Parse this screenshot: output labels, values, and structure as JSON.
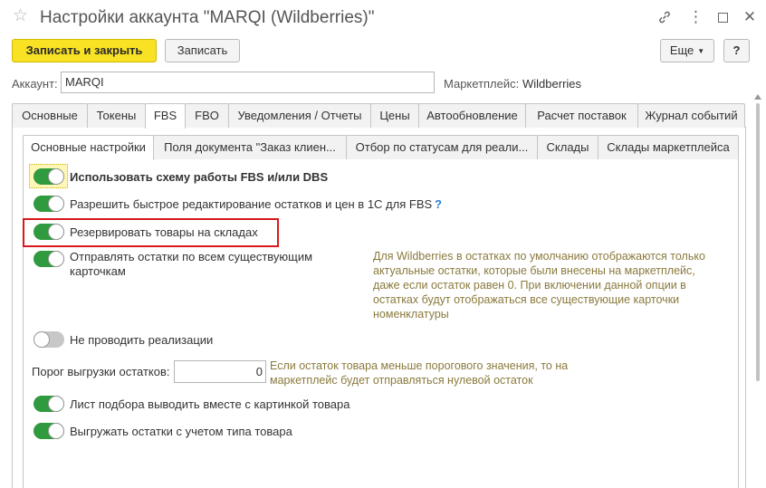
{
  "window": {
    "title": "Настройки аккаунта \"MARQI (Wildberries)\"",
    "icons": [
      "star-icon",
      "link-icon",
      "more-icon",
      "maximize-icon",
      "close-icon"
    ]
  },
  "toolbar": {
    "save_close_label": "Записать и закрыть",
    "save_label": "Записать",
    "more_label": "Еще",
    "help_label": "?"
  },
  "account": {
    "label": "Аккаунт:",
    "value": "MARQI",
    "marketplace_label": "Маркетплейс:",
    "marketplace_value": "Wildberries"
  },
  "tabs": [
    {
      "label": "Основные"
    },
    {
      "label": "Токены"
    },
    {
      "label": "FBS",
      "active": true
    },
    {
      "label": "FBO"
    },
    {
      "label": "Уведомления / Отчеты"
    },
    {
      "label": "Цены"
    },
    {
      "label": "Автообновление"
    },
    {
      "label": "Расчет поставок"
    },
    {
      "label": "Журнал событий"
    }
  ],
  "subtabs": [
    {
      "label": "Основные настройки",
      "active": true
    },
    {
      "label": "Поля документа \"Заказ клиен..."
    },
    {
      "label": "Отбор по статусам для реали..."
    },
    {
      "label": "Склады"
    },
    {
      "label": "Склады маркетплейса"
    }
  ],
  "settings": {
    "use_fbs_dbs": {
      "label": "Использовать схему работы FBS и/или DBS",
      "on": true
    },
    "quick_edit": {
      "label": "Разрешить быстрое редактирование остатков и цен в 1С для FBS",
      "help": "?",
      "on": true
    },
    "reserve": {
      "label": "Резервировать товары на складах",
      "on": true
    },
    "send_all": {
      "label_line1": "Отправлять остатки по всем существующим",
      "label_line2": "карточкам",
      "on": true
    },
    "send_all_note": [
      "Для Wildberries в остатках по умолчанию отображаются только",
      "актуальные остатки, которые были внесены на маркетплейс,",
      "даже если остаток равен 0. При включении данной опции в",
      "остатках будут отображаться все существующие карточки",
      "номенклатуры"
    ],
    "no_sales": {
      "label": "Не проводить реализации",
      "on": false
    },
    "threshold": {
      "label": "Порог выгрузки остатков:",
      "value": "0",
      "note": [
        "Если остаток товара меньше порогового значения, то на",
        "маркетплейс будет отправляться нулевой остаток"
      ]
    },
    "pick_list_image": {
      "label": "Лист подбора выводить вместе с картинкой товара",
      "on": true
    },
    "stock_by_type": {
      "label": "Выгружать остатки с учетом типа товара",
      "on": true
    }
  },
  "colors": {
    "primary_button": "#f8e223",
    "toggle_on": "#2f9a3e",
    "highlight_border": "#d9181d",
    "note_text": "#8a7a3d",
    "help_link": "#2b7bd6"
  }
}
